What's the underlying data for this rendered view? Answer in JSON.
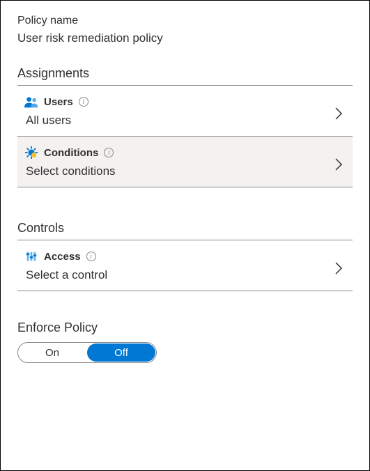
{
  "policy": {
    "name_label": "Policy name",
    "name_value": "User risk remediation policy"
  },
  "assignments": {
    "header": "Assignments",
    "users": {
      "title": "Users",
      "subtitle": "All users"
    },
    "conditions": {
      "title": "Conditions",
      "subtitle": "Select conditions"
    }
  },
  "controls": {
    "header": "Controls",
    "access": {
      "title": "Access",
      "subtitle": "Select a control"
    }
  },
  "enforce": {
    "title": "Enforce Policy",
    "on_label": "On",
    "off_label": "Off",
    "state": "off"
  }
}
